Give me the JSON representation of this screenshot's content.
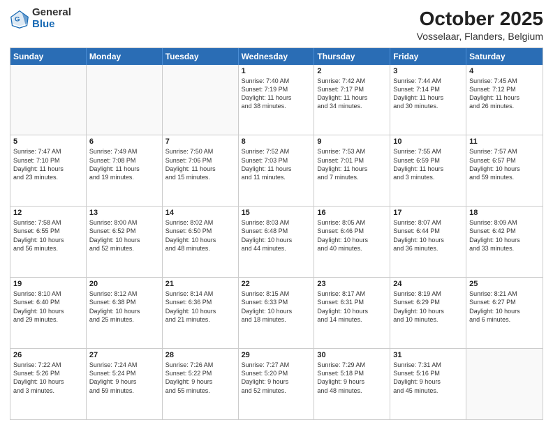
{
  "logo": {
    "general": "General",
    "blue": "Blue"
  },
  "title": "October 2025",
  "subtitle": "Vosselaar, Flanders, Belgium",
  "days": [
    "Sunday",
    "Monday",
    "Tuesday",
    "Wednesday",
    "Thursday",
    "Friday",
    "Saturday"
  ],
  "weeks": [
    [
      {
        "day": "",
        "text": ""
      },
      {
        "day": "",
        "text": ""
      },
      {
        "day": "",
        "text": ""
      },
      {
        "day": "1",
        "text": "Sunrise: 7:40 AM\nSunset: 7:19 PM\nDaylight: 11 hours\nand 38 minutes."
      },
      {
        "day": "2",
        "text": "Sunrise: 7:42 AM\nSunset: 7:17 PM\nDaylight: 11 hours\nand 34 minutes."
      },
      {
        "day": "3",
        "text": "Sunrise: 7:44 AM\nSunset: 7:14 PM\nDaylight: 11 hours\nand 30 minutes."
      },
      {
        "day": "4",
        "text": "Sunrise: 7:45 AM\nSunset: 7:12 PM\nDaylight: 11 hours\nand 26 minutes."
      }
    ],
    [
      {
        "day": "5",
        "text": "Sunrise: 7:47 AM\nSunset: 7:10 PM\nDaylight: 11 hours\nand 23 minutes."
      },
      {
        "day": "6",
        "text": "Sunrise: 7:49 AM\nSunset: 7:08 PM\nDaylight: 11 hours\nand 19 minutes."
      },
      {
        "day": "7",
        "text": "Sunrise: 7:50 AM\nSunset: 7:06 PM\nDaylight: 11 hours\nand 15 minutes."
      },
      {
        "day": "8",
        "text": "Sunrise: 7:52 AM\nSunset: 7:03 PM\nDaylight: 11 hours\nand 11 minutes."
      },
      {
        "day": "9",
        "text": "Sunrise: 7:53 AM\nSunset: 7:01 PM\nDaylight: 11 hours\nand 7 minutes."
      },
      {
        "day": "10",
        "text": "Sunrise: 7:55 AM\nSunset: 6:59 PM\nDaylight: 11 hours\nand 3 minutes."
      },
      {
        "day": "11",
        "text": "Sunrise: 7:57 AM\nSunset: 6:57 PM\nDaylight: 10 hours\nand 59 minutes."
      }
    ],
    [
      {
        "day": "12",
        "text": "Sunrise: 7:58 AM\nSunset: 6:55 PM\nDaylight: 10 hours\nand 56 minutes."
      },
      {
        "day": "13",
        "text": "Sunrise: 8:00 AM\nSunset: 6:52 PM\nDaylight: 10 hours\nand 52 minutes."
      },
      {
        "day": "14",
        "text": "Sunrise: 8:02 AM\nSunset: 6:50 PM\nDaylight: 10 hours\nand 48 minutes."
      },
      {
        "day": "15",
        "text": "Sunrise: 8:03 AM\nSunset: 6:48 PM\nDaylight: 10 hours\nand 44 minutes."
      },
      {
        "day": "16",
        "text": "Sunrise: 8:05 AM\nSunset: 6:46 PM\nDaylight: 10 hours\nand 40 minutes."
      },
      {
        "day": "17",
        "text": "Sunrise: 8:07 AM\nSunset: 6:44 PM\nDaylight: 10 hours\nand 36 minutes."
      },
      {
        "day": "18",
        "text": "Sunrise: 8:09 AM\nSunset: 6:42 PM\nDaylight: 10 hours\nand 33 minutes."
      }
    ],
    [
      {
        "day": "19",
        "text": "Sunrise: 8:10 AM\nSunset: 6:40 PM\nDaylight: 10 hours\nand 29 minutes."
      },
      {
        "day": "20",
        "text": "Sunrise: 8:12 AM\nSunset: 6:38 PM\nDaylight: 10 hours\nand 25 minutes."
      },
      {
        "day": "21",
        "text": "Sunrise: 8:14 AM\nSunset: 6:36 PM\nDaylight: 10 hours\nand 21 minutes."
      },
      {
        "day": "22",
        "text": "Sunrise: 8:15 AM\nSunset: 6:33 PM\nDaylight: 10 hours\nand 18 minutes."
      },
      {
        "day": "23",
        "text": "Sunrise: 8:17 AM\nSunset: 6:31 PM\nDaylight: 10 hours\nand 14 minutes."
      },
      {
        "day": "24",
        "text": "Sunrise: 8:19 AM\nSunset: 6:29 PM\nDaylight: 10 hours\nand 10 minutes."
      },
      {
        "day": "25",
        "text": "Sunrise: 8:21 AM\nSunset: 6:27 PM\nDaylight: 10 hours\nand 6 minutes."
      }
    ],
    [
      {
        "day": "26",
        "text": "Sunrise: 7:22 AM\nSunset: 5:26 PM\nDaylight: 10 hours\nand 3 minutes."
      },
      {
        "day": "27",
        "text": "Sunrise: 7:24 AM\nSunset: 5:24 PM\nDaylight: 9 hours\nand 59 minutes."
      },
      {
        "day": "28",
        "text": "Sunrise: 7:26 AM\nSunset: 5:22 PM\nDaylight: 9 hours\nand 55 minutes."
      },
      {
        "day": "29",
        "text": "Sunrise: 7:27 AM\nSunset: 5:20 PM\nDaylight: 9 hours\nand 52 minutes."
      },
      {
        "day": "30",
        "text": "Sunrise: 7:29 AM\nSunset: 5:18 PM\nDaylight: 9 hours\nand 48 minutes."
      },
      {
        "day": "31",
        "text": "Sunrise: 7:31 AM\nSunset: 5:16 PM\nDaylight: 9 hours\nand 45 minutes."
      },
      {
        "day": "",
        "text": ""
      }
    ]
  ]
}
